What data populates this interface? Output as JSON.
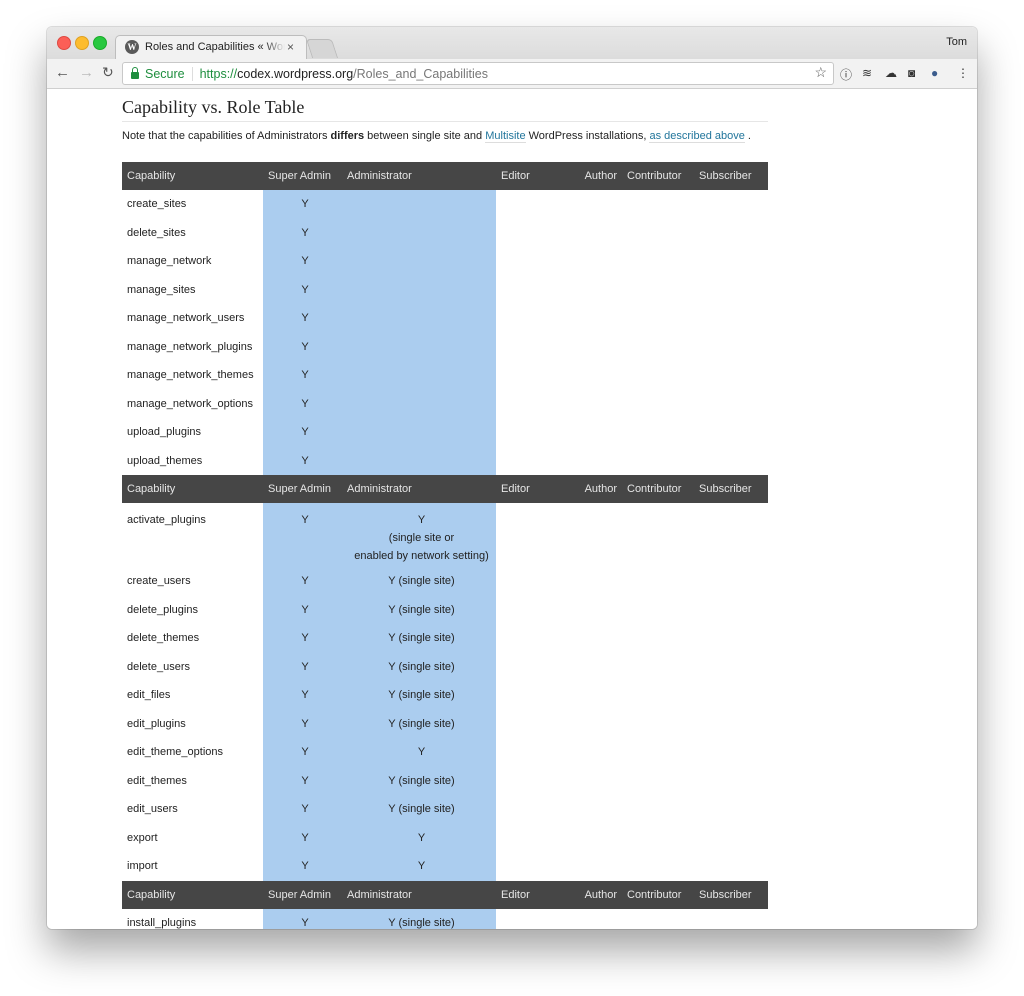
{
  "browser": {
    "tab_title": "Roles and Capabilities « WordPress Codex",
    "tab_close": "×",
    "user": "Tom",
    "secure_label": "Secure",
    "url_scheme": "https://",
    "url_host": "codex.wordpress.org",
    "url_path": "/Roles_and_Capabilities",
    "icons": [
      "back-icon",
      "forward-icon",
      "reload-icon",
      "star-icon",
      "1password-icon",
      "buffer-icon",
      "cloud-icon",
      "pocket-icon",
      "wappalyzer-icon",
      "menu-icon"
    ]
  },
  "page": {
    "heading": "Capability vs. Role Table",
    "note_pre": "Note that the capabilities of Administrators ",
    "note_bold": "differs",
    "note_mid": " between single site and ",
    "note_link1": "Multisite",
    "note_mid2": " WordPress installations, ",
    "note_link2": "as described above",
    "note_end": " ."
  },
  "table": {
    "headers": [
      "Capability",
      "Super Admin",
      "Administrator",
      "Editor",
      "Author",
      "Contributor",
      "Subscriber"
    ],
    "sections": [
      {
        "rows": [
          {
            "cap": "create_sites",
            "sa": "Y",
            "adm": ""
          },
          {
            "cap": "delete_sites",
            "sa": "Y",
            "adm": ""
          },
          {
            "cap": "manage_network",
            "sa": "Y",
            "adm": ""
          },
          {
            "cap": "manage_sites",
            "sa": "Y",
            "adm": ""
          },
          {
            "cap": "manage_network_users",
            "sa": "Y",
            "adm": ""
          },
          {
            "cap": "manage_network_plugins",
            "sa": "Y",
            "adm": ""
          },
          {
            "cap": "manage_network_themes",
            "sa": "Y",
            "adm": ""
          },
          {
            "cap": "manage_network_options",
            "sa": "Y",
            "adm": ""
          },
          {
            "cap": "upload_plugins",
            "sa": "Y",
            "adm": ""
          },
          {
            "cap": "upload_themes",
            "sa": "Y",
            "adm": ""
          }
        ]
      },
      {
        "rows": [
          {
            "cap": "activate_plugins",
            "sa": "Y",
            "adm": "Y\n(single site or\nenabled by network setting)"
          },
          {
            "cap": "create_users",
            "sa": "Y",
            "adm": "Y (single site)"
          },
          {
            "cap": "delete_plugins",
            "sa": "Y",
            "adm": "Y (single site)"
          },
          {
            "cap": "delete_themes",
            "sa": "Y",
            "adm": "Y (single site)"
          },
          {
            "cap": "delete_users",
            "sa": "Y",
            "adm": "Y (single site)"
          },
          {
            "cap": "edit_files",
            "sa": "Y",
            "adm": "Y (single site)"
          },
          {
            "cap": "edit_plugins",
            "sa": "Y",
            "adm": "Y (single site)"
          },
          {
            "cap": "edit_theme_options",
            "sa": "Y",
            "adm": "Y"
          },
          {
            "cap": "edit_themes",
            "sa": "Y",
            "adm": "Y (single site)"
          },
          {
            "cap": "edit_users",
            "sa": "Y",
            "adm": "Y (single site)"
          },
          {
            "cap": "export",
            "sa": "Y",
            "adm": "Y"
          },
          {
            "cap": "import",
            "sa": "Y",
            "adm": "Y"
          }
        ]
      },
      {
        "rows": [
          {
            "cap": "install_plugins",
            "sa": "Y",
            "adm": "Y (single site)"
          }
        ]
      }
    ],
    "highlight_color": "#abcdef",
    "header_color": "#464646"
  }
}
